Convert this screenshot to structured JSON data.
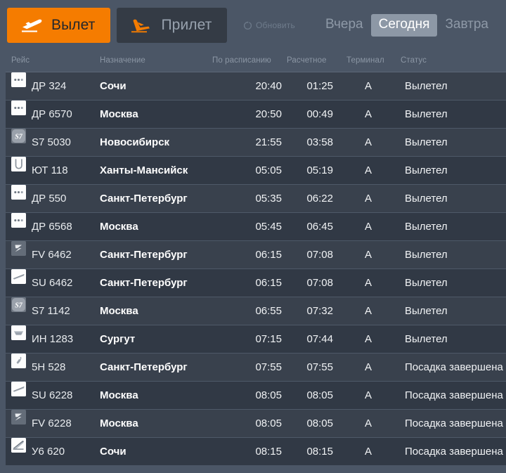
{
  "topbar": {
    "tabs": [
      {
        "id": "departure",
        "label": "Вылет",
        "icon": "plane-departure-icon",
        "active": true
      },
      {
        "id": "arrival",
        "label": "Прилет",
        "icon": "plane-arrival-icon",
        "active": false
      }
    ],
    "refresh": {
      "label": "Обновить",
      "icon": "refresh-icon"
    },
    "days": [
      {
        "id": "yesterday",
        "label": "Вчера",
        "active": false
      },
      {
        "id": "today",
        "label": "Сегодня",
        "active": true
      },
      {
        "id": "tomorrow",
        "label": "Завтра",
        "active": false
      }
    ]
  },
  "colors": {
    "accent_orange": "#f57c00",
    "page_bg": "#4b5666",
    "row_bg": "#39414d",
    "row_bg_alt": "#313945",
    "tab_inactive_bg": "#343b45",
    "header_text": "#8b96a4",
    "day_active_bg": "#8d98a6"
  },
  "table": {
    "headers": [
      {
        "key": "flight",
        "label": "Рейс"
      },
      {
        "key": "destination",
        "label": "Назначение"
      },
      {
        "key": "scheduled",
        "label": "По расписанию"
      },
      {
        "key": "estimated",
        "label": "Расчетное"
      },
      {
        "key": "terminal",
        "label": "Терминал"
      },
      {
        "key": "status",
        "label": "Статус"
      }
    ],
    "rows": [
      {
        "logo": "airline-logo-dr",
        "flight": "ДР 324",
        "destination": "Сочи",
        "scheduled": "20:40",
        "estimated": "01:25",
        "terminal": "A",
        "status": "Вылетел"
      },
      {
        "logo": "airline-logo-dr",
        "flight": "ДР 6570",
        "destination": "Москва",
        "scheduled": "20:50",
        "estimated": "00:49",
        "terminal": "A",
        "status": "Вылетел"
      },
      {
        "logo": "airline-logo-s7",
        "flight": "S7 5030",
        "destination": "Новосибирск",
        "scheduled": "21:55",
        "estimated": "03:58",
        "terminal": "A",
        "status": "Вылетел"
      },
      {
        "logo": "airline-logo-ut",
        "flight": "ЮТ 118",
        "destination": "Ханты-Мансийск",
        "scheduled": "05:05",
        "estimated": "05:19",
        "terminal": "A",
        "status": "Вылетел"
      },
      {
        "logo": "airline-logo-dr",
        "flight": "ДР 550",
        "destination": "Санкт-Петербург",
        "scheduled": "05:35",
        "estimated": "06:22",
        "terminal": "A",
        "status": "Вылетел"
      },
      {
        "logo": "airline-logo-dr",
        "flight": "ДР 6568",
        "destination": "Москва",
        "scheduled": "05:45",
        "estimated": "06:45",
        "terminal": "A",
        "status": "Вылетел"
      },
      {
        "logo": "airline-logo-fv",
        "flight": "FV 6462",
        "destination": "Санкт-Петербург",
        "scheduled": "06:15",
        "estimated": "07:08",
        "terminal": "A",
        "status": "Вылетел"
      },
      {
        "logo": "airline-logo-su",
        "flight": "SU 6462",
        "destination": "Санкт-Петербург",
        "scheduled": "06:15",
        "estimated": "07:08",
        "terminal": "A",
        "status": "Вылетел"
      },
      {
        "logo": "airline-logo-s7",
        "flight": "S7 1142",
        "destination": "Москва",
        "scheduled": "06:55",
        "estimated": "07:32",
        "terminal": "A",
        "status": "Вылетел"
      },
      {
        "logo": "airline-logo-in",
        "flight": "ИН 1283",
        "destination": "Сургут",
        "scheduled": "07:15",
        "estimated": "07:44",
        "terminal": "A",
        "status": "Вылетел"
      },
      {
        "logo": "airline-logo-5n",
        "flight": "5Н 528",
        "destination": "Санкт-Петербург",
        "scheduled": "07:55",
        "estimated": "07:55",
        "terminal": "A",
        "status": "Посадка завершена"
      },
      {
        "logo": "airline-logo-su",
        "flight": "SU 6228",
        "destination": "Москва",
        "scheduled": "08:05",
        "estimated": "08:05",
        "terminal": "A",
        "status": "Посадка завершена"
      },
      {
        "logo": "airline-logo-fv",
        "flight": "FV 6228",
        "destination": "Москва",
        "scheduled": "08:05",
        "estimated": "08:05",
        "terminal": "A",
        "status": "Посадка завершена"
      },
      {
        "logo": "airline-logo-u6",
        "flight": "У6 620",
        "destination": "Сочи",
        "scheduled": "08:15",
        "estimated": "08:15",
        "terminal": "A",
        "status": "Посадка завершена"
      }
    ]
  }
}
